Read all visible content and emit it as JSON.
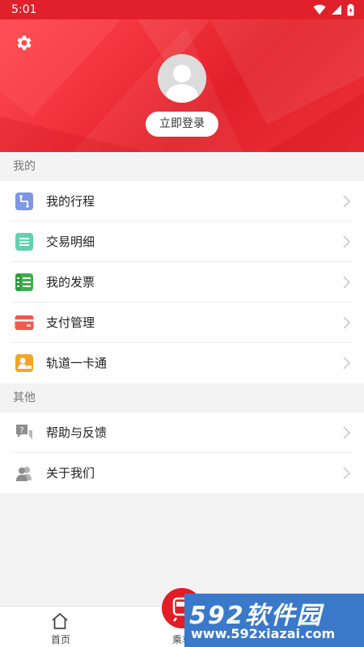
{
  "status_bar": {
    "time": "5:01"
  },
  "header": {
    "login_label": "立即登录"
  },
  "sections": {
    "mine": {
      "title": "我的",
      "items": [
        {
          "label": "我的行程",
          "icon": "route-icon",
          "color": "#7f95e6"
        },
        {
          "label": "交易明细",
          "icon": "list-detail-icon",
          "color": "#5fd2ae"
        },
        {
          "label": "我的发票",
          "icon": "invoice-icon",
          "color": "#3fae4e"
        },
        {
          "label": "支付管理",
          "icon": "card-icon",
          "color": "#f05a4a"
        },
        {
          "label": "轨道一卡通",
          "icon": "id-card-icon",
          "color": "#f3a529"
        }
      ]
    },
    "other": {
      "title": "其他",
      "items": [
        {
          "label": "帮助与反馈",
          "icon": "help-chat-icon",
          "color": "#8e8e8e"
        },
        {
          "label": "关于我们",
          "icon": "people-icon",
          "color": "#8e8e8e"
        }
      ]
    }
  },
  "tabbar": {
    "home_label": "首页",
    "ride_label": "乘车"
  },
  "watermark": {
    "main": "592软件园",
    "url": "www.592xiazai.com"
  },
  "colors": {
    "brand_red": "#e0202a",
    "background": "#f3f3f3"
  }
}
